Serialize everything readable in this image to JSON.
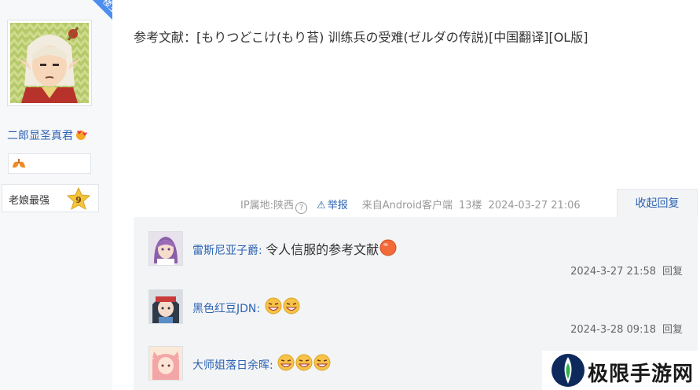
{
  "author": {
    "username": "二郎显圣真君",
    "corner_label": "楼主",
    "level_title": "老娘最强",
    "level_number": "9"
  },
  "post": {
    "text": "参考文献：[もりつどこけ(もり苔) 训练兵の受难(ゼルダの传説)[中国翻译][OL版]"
  },
  "meta": {
    "ip": "IP属地:陕西",
    "help": "?",
    "report": "举报",
    "source": "来自Android客户端",
    "floor": "13楼",
    "time": "2024-03-27 21:06",
    "collapse": "收起回复"
  },
  "replies": [
    {
      "name": "雷斯尼亚子爵:",
      "text": "令人信服的参考文献",
      "time": "2024-3-27 21:58",
      "reply_label": "回复"
    },
    {
      "name": "黑色红豆JDN:",
      "text": "",
      "time": "2024-3-28 09:18",
      "reply_label": "回复"
    },
    {
      "name": "大师姐落日余晖:",
      "text": "",
      "time": "",
      "reply_label": ""
    }
  ],
  "watermark": {
    "text": "极限手游网"
  },
  "colors": {
    "link": "#2d64b3",
    "accent": "#4b8ef0",
    "panel": "#f3f4f6"
  }
}
